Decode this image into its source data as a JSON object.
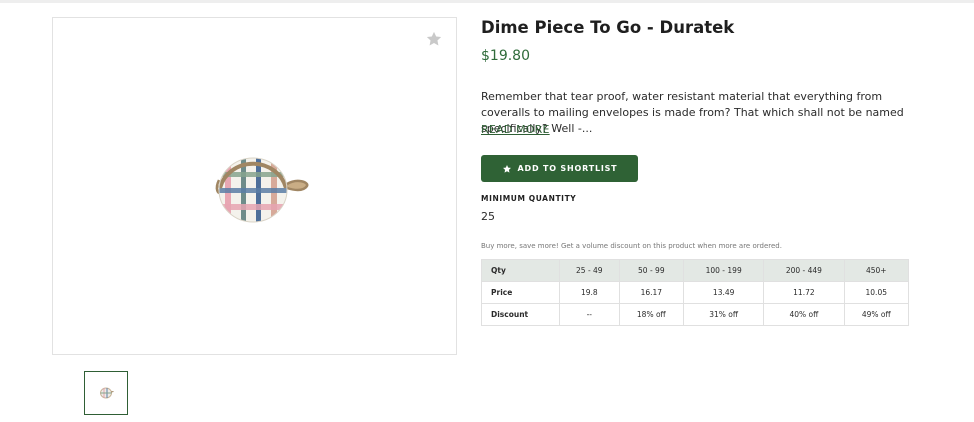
{
  "product": {
    "title": "Dime Piece To Go - Duratek",
    "price": "$19.80",
    "description": "Remember that tear proof, water resistant material that everything from coveralls to mailing envelopes is made from? That which shall not be named specifically? Well -...",
    "read_more_label": "READ MORE",
    "shortlist_button_label": "ADD TO SHORTLIST",
    "minimum_quantity_label": "MINIMUM QUANTITY",
    "minimum_quantity_value": "25",
    "volume_note": "Buy more, save more! Get a volume discount on this product when more are ordered."
  },
  "pricing_table": {
    "header": [
      "Qty",
      "25 - 49",
      "50 - 99",
      "100 - 199",
      "200 - 449",
      "450+"
    ],
    "rows": [
      [
        "Price",
        "19.8",
        "16.17",
        "13.49",
        "11.72",
        "10.05"
      ],
      [
        "Discount",
        "--",
        "18% off",
        "31% off",
        "40% off",
        "49% off"
      ]
    ]
  },
  "icons": {
    "favorite": "star-icon",
    "shortlist": "star-icon"
  },
  "colors": {
    "accent_green": "#2f6235",
    "price_green": "#2f6b3a",
    "table_header_bg": "#e3e8e4"
  }
}
